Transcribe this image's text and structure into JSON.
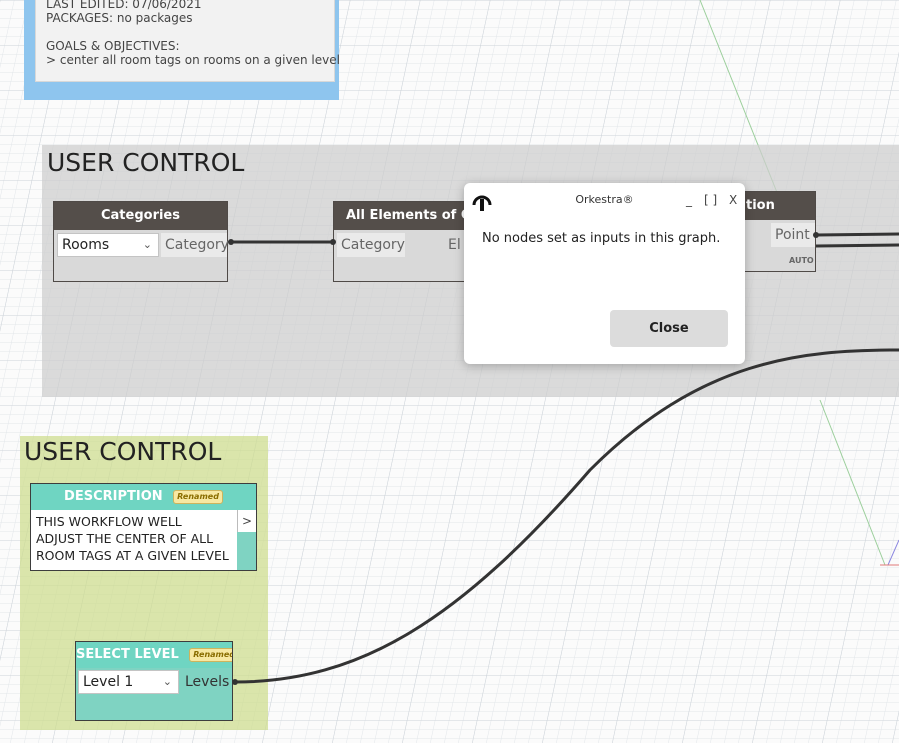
{
  "info_note": {
    "last_edited": "LAST EDITED: 07/06/2021",
    "packages": "PACKAGES: no packages",
    "goals_heading": "GOALS & OBJECTIVES:",
    "goals_item": "> center all room tags on rooms on a given level"
  },
  "group_top": {
    "title": "USER CONTROL"
  },
  "group_bottom": {
    "title": "USER CONTROL"
  },
  "nodes": {
    "categories": {
      "title": "Categories",
      "selected": "Rooms",
      "output": "Category"
    },
    "all_elements": {
      "title": "All Elements of Ca",
      "input": "Category",
      "output_partial": "El"
    },
    "location": {
      "title_partial": "tion",
      "output": "Point",
      "lacing": "AUTO"
    },
    "description": {
      "title": "DESCRIPTION",
      "badge": "Renamed",
      "text": "THIS WORKFLOW WELL ADJUST THE CENTER OF ALL ROOM TAGS AT A GIVEN LEVEL",
      "output": ">"
    },
    "select_level": {
      "title": "SELECT LEVEL",
      "badge": "Renamed",
      "selected": "Level 1",
      "output": "Levels"
    }
  },
  "dialog": {
    "title": "Orkestra®",
    "minimize": "_",
    "maximize": "[ ]",
    "close_x": "X",
    "message": "No nodes set as inputs in this graph.",
    "close_button": "Close"
  },
  "colors": {
    "node_header": "#544e4a",
    "green_node": "#6fd5c2",
    "info_group": "#8ec5ee",
    "green_group": "#cddc8c"
  }
}
